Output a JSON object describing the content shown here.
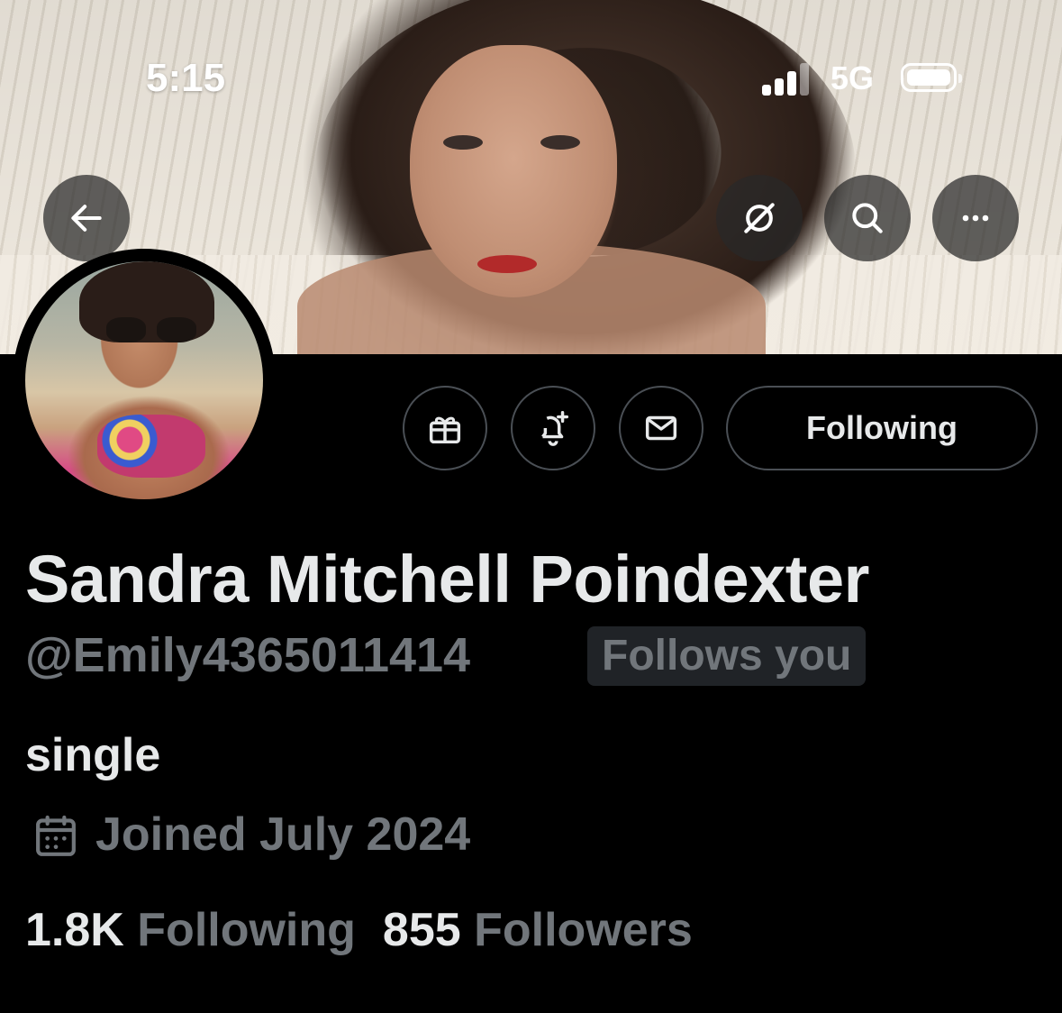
{
  "status_bar": {
    "time": "5:15",
    "network": "5G"
  },
  "banner": {
    "description_icons": [
      "back-arrow-icon",
      "grok-icon",
      "search-icon",
      "more-icon"
    ]
  },
  "actions": {
    "following_label": "Following",
    "icons": [
      "gift-icon",
      "bell-plus-icon",
      "mail-icon"
    ]
  },
  "profile": {
    "display_name": "Sandra Mitchell Poindexter",
    "handle": "@Emily4365011414",
    "follows_you": "Follows you",
    "bio": "single",
    "joined": "Joined July 2024"
  },
  "stats": {
    "following_count": "1.8K",
    "following_label": "Following",
    "followers_count": "855",
    "followers_label": "Followers"
  },
  "colors": {
    "background": "#000000",
    "primary_text": "#e7e9ea",
    "secondary_text": "#71767b",
    "border": "#4a4f55",
    "badge_bg": "#202327"
  }
}
